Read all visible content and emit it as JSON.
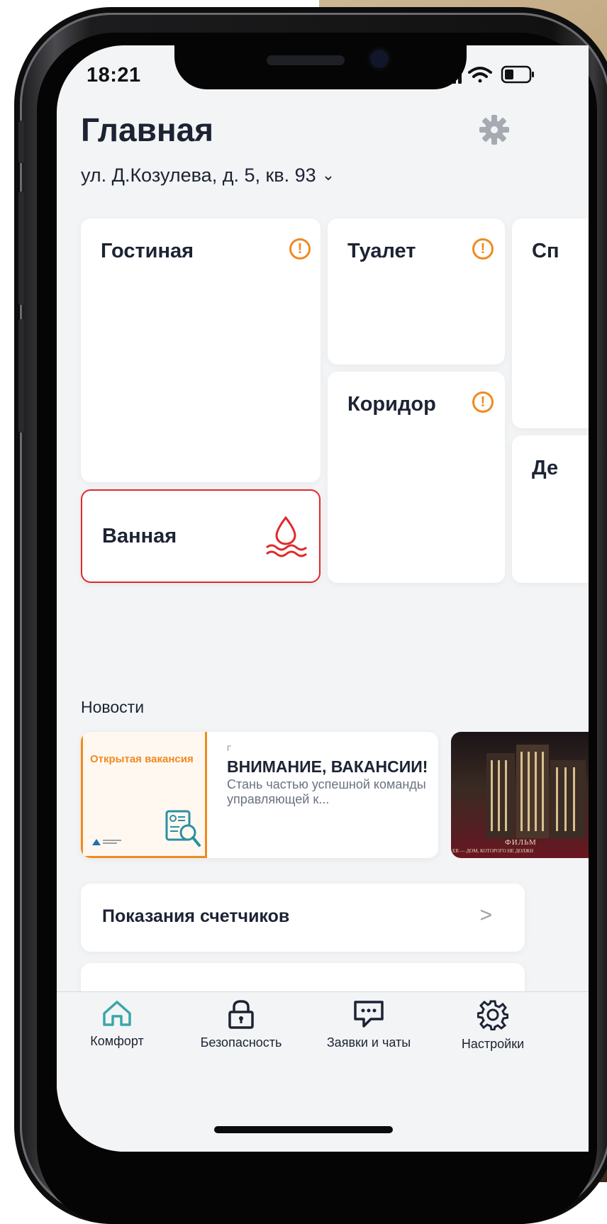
{
  "status": {
    "time": "18:21"
  },
  "header": {
    "title": "Главная",
    "address": "ул. Д.Козулева, д. 5, кв. 93"
  },
  "rooms": [
    {
      "name": "Гостиная",
      "state": "warning"
    },
    {
      "name": "Туалет",
      "state": "warning"
    },
    {
      "name": "Сп",
      "state": "partial"
    },
    {
      "name": "Коридор",
      "state": "warning"
    },
    {
      "name": "Де",
      "state": "partial"
    },
    {
      "name": "Ванная",
      "state": "leak"
    }
  ],
  "news": {
    "label": "Новости",
    "items": [
      {
        "thumb_title": "Открытая вакансия",
        "mark": "Г",
        "title": "ВНИМАНИЕ, ВАКАНСИИ!",
        "subtitle": "Стань частью успешной команды управляющей к..."
      },
      {
        "film_label": "ФИЛЬМ",
        "film_sub": "ЕВ — ДОМ, КОТОРОГО НЕ ДОЛЖН"
      }
    ]
  },
  "menu": [
    {
      "label": "Показания счетчиков",
      "arrow": ">"
    }
  ],
  "tabbar": {
    "items": [
      {
        "label": "Комфорт",
        "icon": "home-icon",
        "active": true
      },
      {
        "label": "Безопасность",
        "icon": "lock-icon",
        "active": false
      },
      {
        "label": "Заявки и чаты",
        "icon": "chat-icon",
        "active": false
      },
      {
        "label": "Настройки",
        "icon": "gear-icon",
        "active": false
      }
    ]
  },
  "colors": {
    "accent_warning": "#f08a1f",
    "alert": "#e02a2a",
    "active_tab": "#3aa6a9",
    "text": "#1c2333"
  }
}
